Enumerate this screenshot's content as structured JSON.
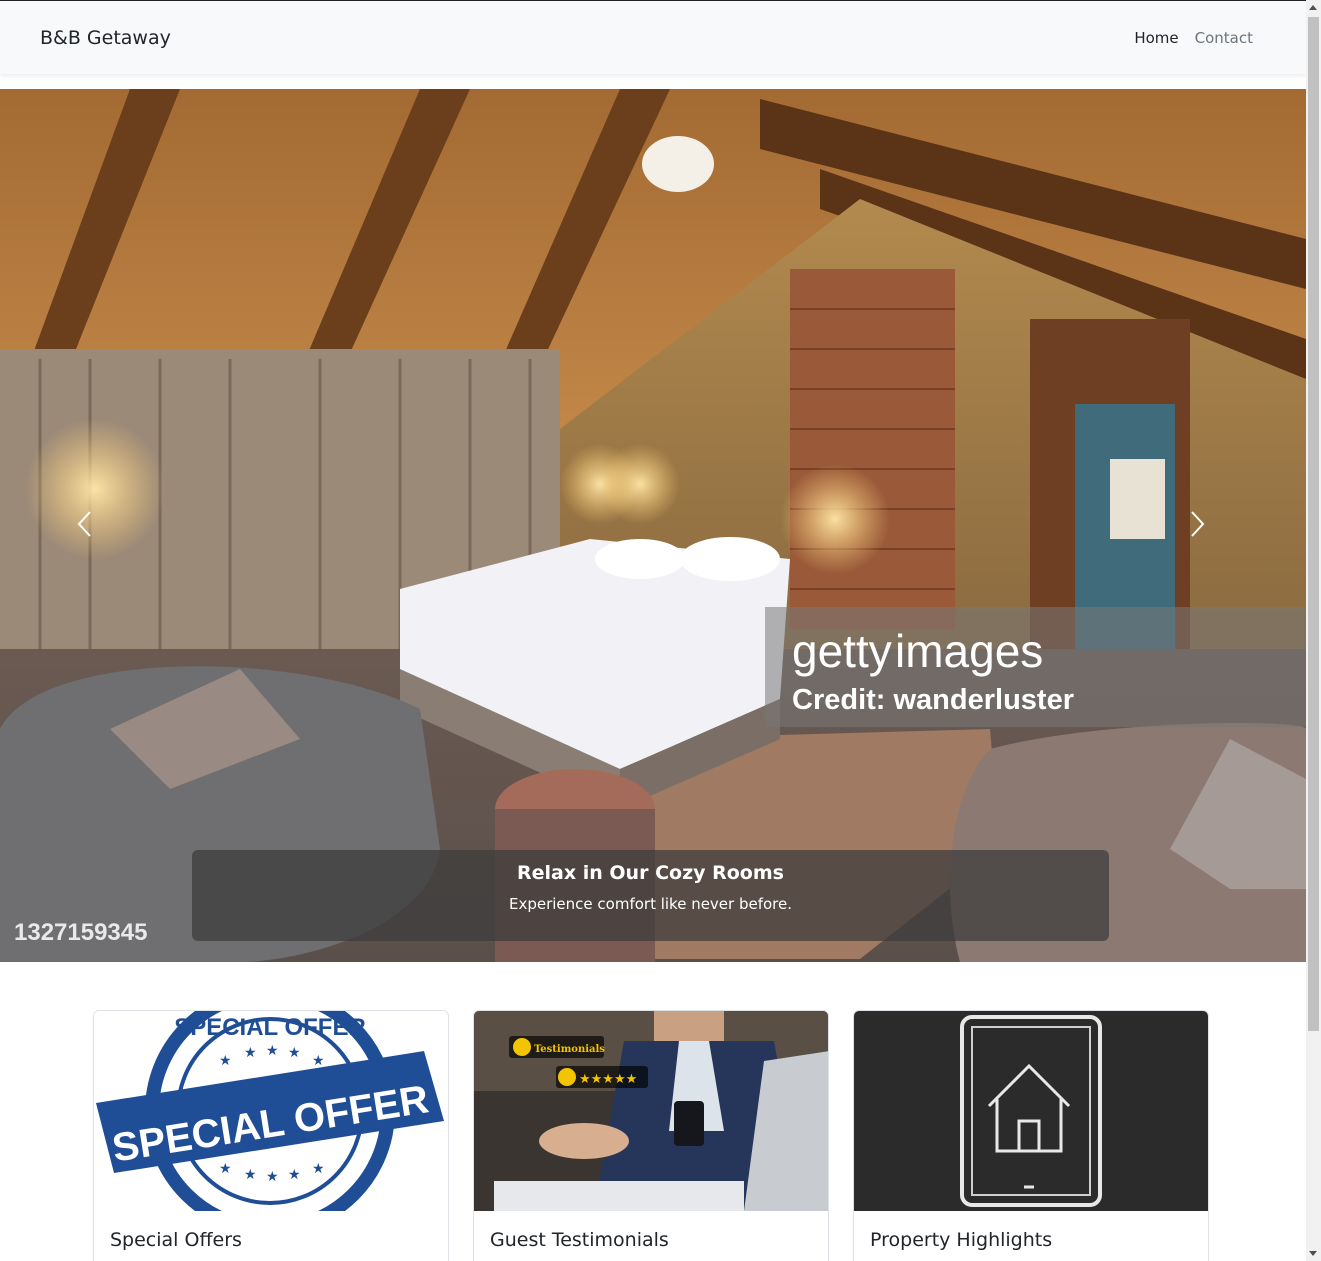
{
  "navbar": {
    "brand": "B&B Getaway",
    "links": [
      {
        "label": "Home"
      },
      {
        "label": "Contact"
      }
    ]
  },
  "hero": {
    "caption_title": "Relax in Our Cozy Rooms",
    "caption_text": "Experience comfort like never before.",
    "watermark_brand_a": "getty",
    "watermark_brand_b": "images",
    "watermark_credit": "Credit: wanderluster",
    "watermark_id": "1327159345"
  },
  "cards": [
    {
      "title": "Special Offers",
      "image_text_main": "SPECIAL OFFER",
      "image_text_ring": "SPECIAL OFFER"
    },
    {
      "title": "Guest Testimonials",
      "image_text": "Testimonials",
      "image_stars": "★★★★★"
    },
    {
      "title": "Property Highlights"
    }
  ],
  "colors": {
    "navbar_bg": "#f8f9fa",
    "stamp_blue": "#1f4e96",
    "highlight_bg": "#2b2b2b"
  }
}
